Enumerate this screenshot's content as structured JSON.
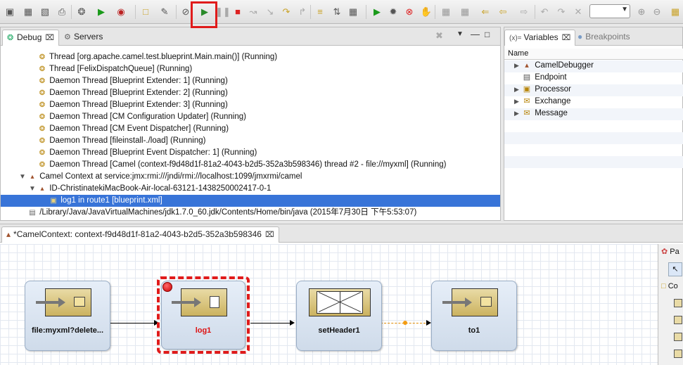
{
  "colors": {
    "accent": "#3874d8",
    "highlight": "#e01b1b",
    "breakpoint": "#cc0000"
  },
  "debug_panel": {
    "tabs": [
      {
        "label": "Debug",
        "icon": "bug-icon"
      },
      {
        "label": "Servers",
        "icon": "servers-icon"
      }
    ],
    "rows": [
      {
        "icon": "thread-icon",
        "text": "Thread [org.apache.camel.test.blueprint.Main.main()] (Running)"
      },
      {
        "icon": "thread-icon",
        "text": "Thread [FelixDispatchQueue] (Running)"
      },
      {
        "icon": "thread-icon",
        "text": "Daemon Thread [Blueprint Extender: 1] (Running)"
      },
      {
        "icon": "thread-icon",
        "text": "Daemon Thread [Blueprint Extender: 2] (Running)"
      },
      {
        "icon": "thread-icon",
        "text": "Daemon Thread [Blueprint Extender: 3] (Running)"
      },
      {
        "icon": "thread-icon",
        "text": "Daemon Thread [CM Configuration Updater] (Running)"
      },
      {
        "icon": "thread-icon",
        "text": "Daemon Thread [CM Event Dispatcher] (Running)"
      },
      {
        "icon": "thread-icon",
        "text": "Daemon Thread [fileinstall-./load] (Running)"
      },
      {
        "icon": "thread-icon",
        "text": "Daemon Thread [Blueprint Event Dispatcher: 1] (Running)"
      },
      {
        "icon": "thread-icon",
        "text": "Daemon Thread [Camel (context-f9d48d1f-81a2-4043-b2d5-352a3b598346) thread #2 - file://myxml] (Running)"
      },
      {
        "icon": "camel-icon",
        "text": "Camel Context at service:jmx:rmi:///jndi/rmi://localhost:1099/jmxrmi/camel"
      },
      {
        "icon": "camel-icon",
        "text": "ID-ChristinatekiMacBook-Air-local-63121-1438250002417-0-1"
      },
      {
        "icon": "endpoint-icon",
        "text": "log1 in route1 [blueprint.xml]"
      },
      {
        "icon": "java-process-icon",
        "text": "/Library/Java/JavaVirtualMachines/jdk1.7.0_60.jdk/Contents/Home/bin/java (2015年7月30日 下午5:53:07)"
      }
    ]
  },
  "variables_panel": {
    "tabs": [
      {
        "label": "Variables",
        "icon": "variables-icon"
      },
      {
        "label": "Breakpoints",
        "icon": "breakpoints-icon"
      }
    ],
    "column_header": "Name",
    "rows": [
      {
        "label": "CamelDebugger",
        "expandable": true,
        "icon": "camel-icon"
      },
      {
        "label": "Endpoint",
        "expandable": false,
        "icon": "endpoint-icon"
      },
      {
        "label": "Processor",
        "expandable": true,
        "icon": "processor-icon"
      },
      {
        "label": "Exchange",
        "expandable": true,
        "icon": "envelope-icon"
      },
      {
        "label": "Message",
        "expandable": true,
        "icon": "envelope-icon"
      }
    ]
  },
  "editor": {
    "tab_label": "*CamelContext: context-f9d48d1f-81a2-4043-b2d5-352a3b598346",
    "nodes": [
      {
        "label": "file:myxml?delete...",
        "icon": "folder-icon"
      },
      {
        "label": "log1",
        "icon": "log-icon",
        "breakpoint": true,
        "selected": true
      },
      {
        "label": "setHeader1",
        "icon": "setheader-icon"
      },
      {
        "label": "to1",
        "icon": "folder-icon"
      }
    ],
    "palette": {
      "title": "Pa",
      "section": "Co"
    }
  }
}
